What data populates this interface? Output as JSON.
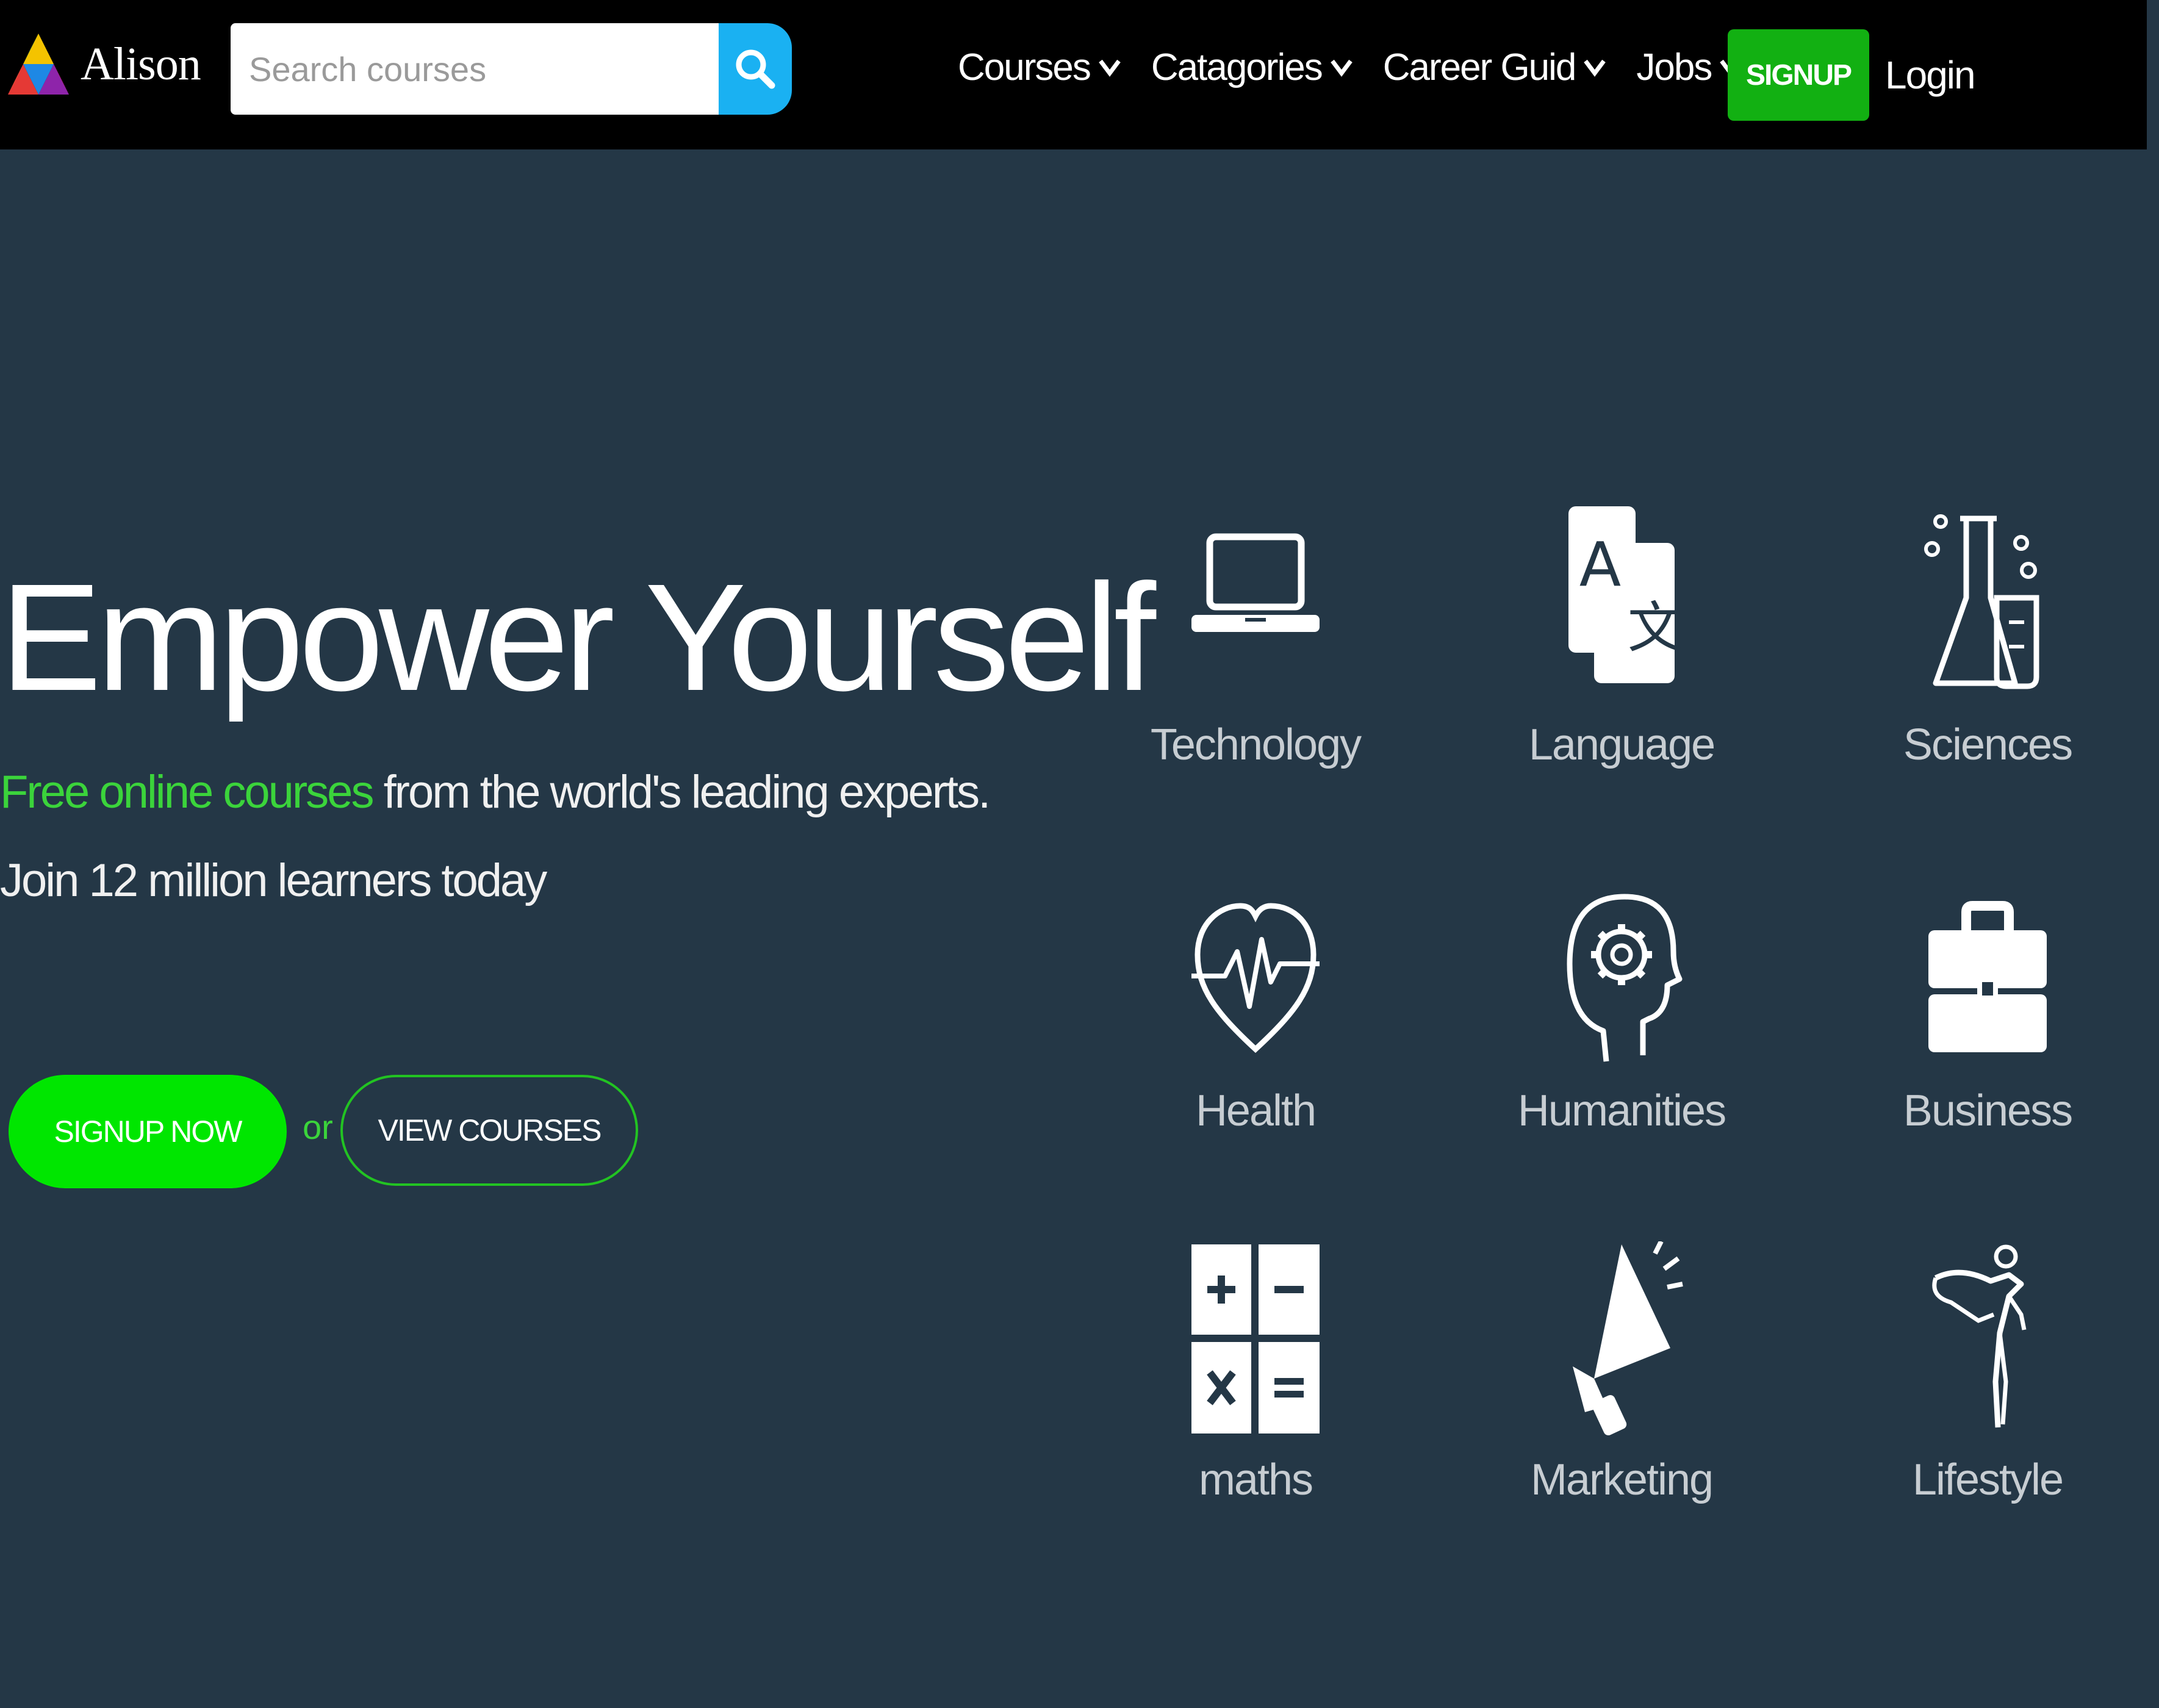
{
  "brand": {
    "name": "Alison"
  },
  "search": {
    "placeholder": "Search courses"
  },
  "nav": {
    "items": [
      {
        "label": "Courses"
      },
      {
        "label": "Catagories"
      },
      {
        "label": "Career Guid"
      },
      {
        "label": "Jobs"
      }
    ],
    "signup_label": "SIGNUP",
    "login_label": "Login"
  },
  "hero": {
    "title": "Empower Yourself",
    "subtitle_highlight": "Free online courses",
    "subtitle_rest": " from the world's leading experts.",
    "join_text": "Join 12 million learners today",
    "signup_now_label": "SIGNUP NOW",
    "or_text": "or",
    "view_courses_label": "VIEW COURSES"
  },
  "categories": [
    {
      "label": "Technology",
      "icon": "laptop-icon"
    },
    {
      "label": "Language",
      "icon": "translate-icon"
    },
    {
      "label": "Sciences",
      "icon": "flask-icon"
    },
    {
      "label": "Health",
      "icon": "heartbeat-icon"
    },
    {
      "label": "Humanities",
      "icon": "head-gear-icon"
    },
    {
      "label": "Business",
      "icon": "briefcase-icon"
    },
    {
      "label": "maths",
      "icon": "calculator-icon"
    },
    {
      "label": "Marketing",
      "icon": "megaphone-icon"
    },
    {
      "label": "Lifestyle",
      "icon": "dancer-icon"
    }
  ],
  "colors": {
    "background": "#243746",
    "navbar": "#000000",
    "accent_green": "#00e600",
    "signup_green": "#12b012",
    "search_blue": "#1ab1f2",
    "highlight_text": "#3bd43b"
  }
}
